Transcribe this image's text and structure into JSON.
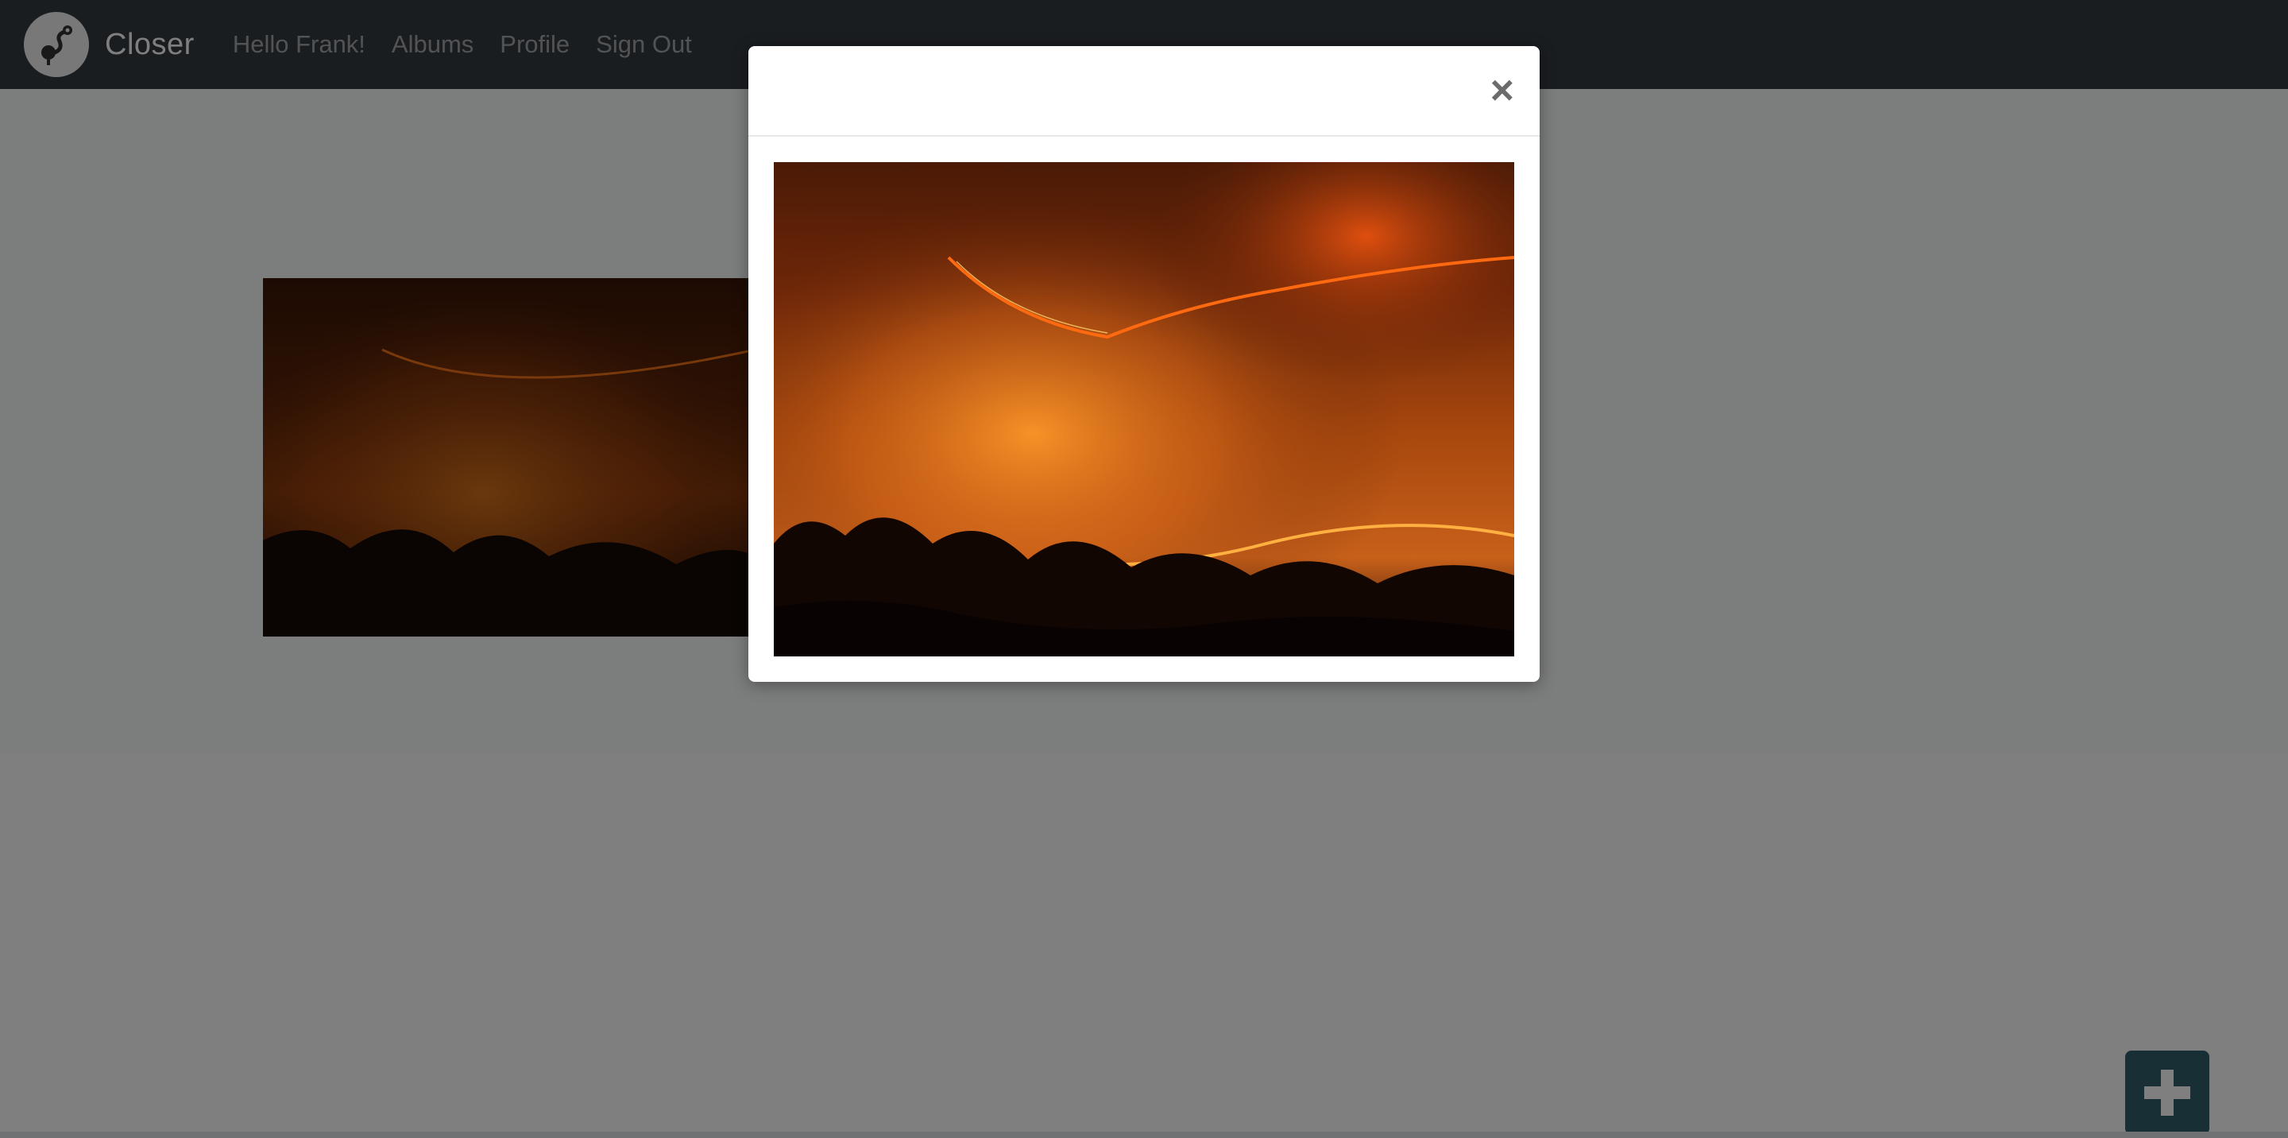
{
  "navbar": {
    "brand": "Closer",
    "links": [
      {
        "label": "Hello Frank!"
      },
      {
        "label": "Albums"
      },
      {
        "label": "Profile"
      },
      {
        "label": "Sign Out"
      }
    ],
    "logo_icon": "map-pin-note-logo"
  },
  "gallery": {
    "photos": [
      {
        "subject": "forest-fire-at-night"
      }
    ]
  },
  "fab": {
    "icon": "plus-icon",
    "color": "#2e5e6a"
  },
  "modal": {
    "close_label": "×",
    "photo_subject": "forest-fire-at-night"
  },
  "colors": {
    "navbar": "#343a40",
    "accent": "#2e5e6a"
  }
}
